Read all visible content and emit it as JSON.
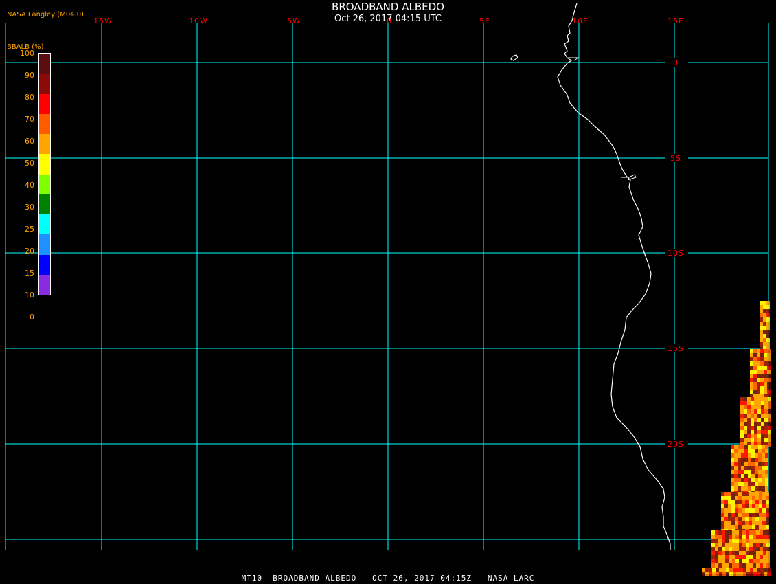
{
  "header": {
    "title": "BROADBAND ALBEDO",
    "datetime": "Oct 26, 2017 04:15 UTC",
    "credit": "NASA Langley (M04.0)"
  },
  "footer": {
    "text": "MT10  BROADBAND ALBEDO   OCT 26, 2017 04:15Z   NASA LARC"
  },
  "colorbar": {
    "title": "BBALB (%)",
    "labels": [
      "100",
      "90",
      "80",
      "70",
      "60",
      "50",
      "40",
      "30",
      "25",
      "20",
      "15",
      "10",
      "0"
    ],
    "bins": [
      {
        "color": "#5a0e0e"
      },
      {
        "color": "#8b0a0a"
      },
      {
        "color": "#ff0000"
      },
      {
        "color": "#ff5a00"
      },
      {
        "color": "#ffa500"
      },
      {
        "color": "#ffff00"
      },
      {
        "color": "#80ff00"
      },
      {
        "color": "#008000"
      },
      {
        "color": "#00ffff"
      },
      {
        "color": "#1e90ff"
      },
      {
        "color": "#0000ff"
      },
      {
        "color": "#8a2be2"
      }
    ]
  },
  "map": {
    "grid_color": "#00ffff",
    "label_color": "#ff0000",
    "coast_color": "#ffffff",
    "lon_labels": [
      "15W",
      "10W",
      "5W",
      "0",
      "5E",
      "10E",
      "15E"
    ],
    "lat_labels": [
      "0",
      "5S",
      "10S",
      "15S",
      "20S"
    ]
  }
}
